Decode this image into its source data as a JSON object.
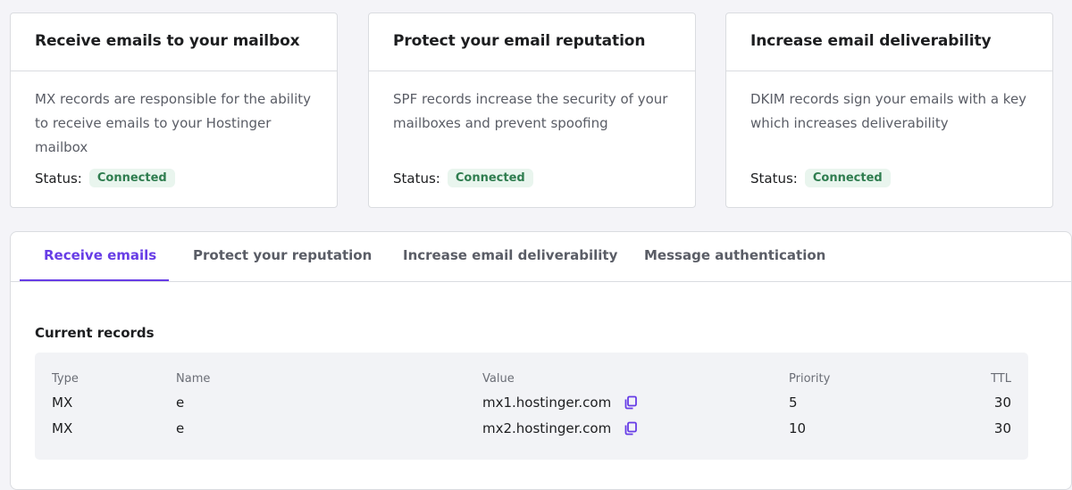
{
  "cards": [
    {
      "title": "Receive emails to your mailbox",
      "description": "MX records are responsible for the ability to receive emails to your Hostinger mailbox",
      "status_label": "Status:",
      "status_value": "Connected"
    },
    {
      "title": "Protect your email reputation",
      "description": "SPF records increase the security of your mailboxes and prevent spoofing",
      "status_label": "Status:",
      "status_value": "Connected"
    },
    {
      "title": "Increase email deliverability",
      "description": "DKIM records sign your emails with a key which increases deliverability",
      "status_label": "Status:",
      "status_value": "Connected"
    }
  ],
  "tabs": [
    {
      "label": "Receive emails",
      "active": true
    },
    {
      "label": "Protect your reputation",
      "active": false
    },
    {
      "label": "Increase email deliverability",
      "active": false
    },
    {
      "label": "Message authentication",
      "active": false
    }
  ],
  "records": {
    "title": "Current records",
    "headers": {
      "type": "Type",
      "name": "Name",
      "value": "Value",
      "priority": "Priority",
      "ttl": "TTL"
    },
    "rows": [
      {
        "type": "MX",
        "name": "e",
        "value": "mx1.hostinger.com",
        "priority": "5",
        "ttl": "30"
      },
      {
        "type": "MX",
        "name": "e",
        "value": "mx2.hostinger.com",
        "priority": "10",
        "ttl": "30"
      }
    ]
  },
  "colors": {
    "accent": "#673de6",
    "badge_bg": "#e9f5ee",
    "badge_text": "#2f7d4f"
  },
  "icons": {
    "copy": "copy-icon"
  }
}
